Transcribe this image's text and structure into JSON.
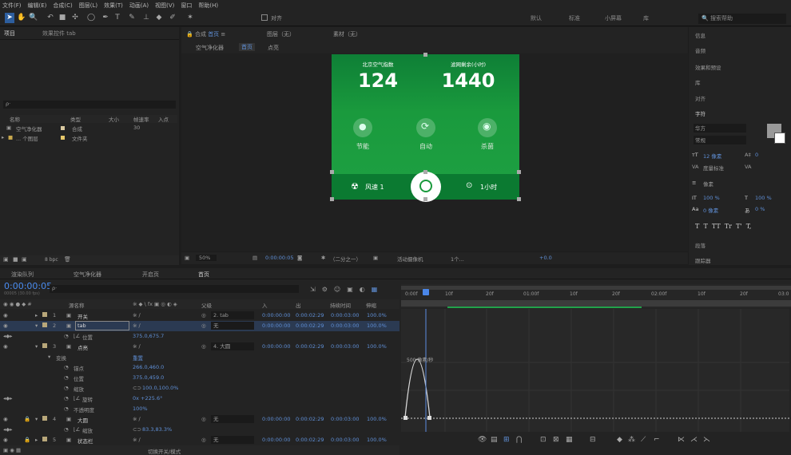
{
  "menu": [
    "文件(F)",
    "编辑(E)",
    "合成(C)",
    "图层(L)",
    "效果(T)",
    "动画(A)",
    "视图(V)",
    "窗口",
    "帮助(H)"
  ],
  "toolbar": {
    "align_label": "对齐",
    "workspaces": [
      "默认",
      "了解",
      "标准",
      "小屏幕",
      "库"
    ],
    "search_help": "搜索帮助"
  },
  "project": {
    "tab": "项目",
    "effects_tab": "效果控件 tab",
    "search": "ρ·",
    "columns": [
      "名称",
      "类型",
      "大小",
      "帧速率",
      "入点"
    ],
    "items": [
      {
        "name": "空气净化器",
        "type": "合成",
        "fps": "30"
      },
      {
        "name": "... 个图层",
        "type": "文件夹"
      }
    ],
    "bpc": "8 bpc"
  },
  "viewer": {
    "tab": "合成",
    "tab_name": "首页",
    "layer_tab": "图层（无）",
    "footage_tab": "素材（无）",
    "breadcrumbs": [
      "空气净化器",
      "首页",
      "点亮"
    ],
    "zoom": "50%",
    "timecode": "0:00:00:05",
    "resolution": "（二分之一）",
    "camera": "活动摄像机",
    "views": "1个...",
    "exposure": "+0.0"
  },
  "screen": {
    "label1": "北京空气指数",
    "value1": "124",
    "label2": "滤网剩余(小时)",
    "value2": "1440",
    "icons": [
      "节能",
      "自动",
      "杀菌"
    ],
    "fan": "风速 1",
    "timer": "1小时"
  },
  "right": {
    "items": [
      "信息",
      "音频",
      "效果和预设",
      "库",
      "对齐"
    ],
    "char_title": "字符",
    "font": "华方",
    "style": "常规",
    "size": "12 像素",
    "leading": "自动",
    "tracking": "像素",
    "scale_v": "100 %",
    "scale_h": "100 %",
    "baseline": "0 像素",
    "tsume": "0 %",
    "kerning": "度量标准",
    "tracking_val": "0",
    "stroke": "像素",
    "para": "段落",
    "tracker": "跟踪器",
    "type_buttons": [
      "T",
      "T",
      "TT",
      "Tr",
      "T'",
      "T,"
    ]
  },
  "timeline": {
    "tabs": [
      "渲染队列",
      "空气净化器",
      "开启页",
      "首页"
    ],
    "timecode": "0:00:00:05",
    "fps_sub": "00005 (30.00 fps)",
    "search": "ρ·",
    "cols": [
      "源名称",
      "父级",
      "入",
      "出",
      "持续时间",
      "伸缩"
    ],
    "layers": [
      {
        "idx": "1",
        "name": "开关",
        "parent": "2. tab",
        "in": "0:00:00:00",
        "out": "0:00:02:29",
        "dur": "0:00:03:00",
        "st": "100.0%"
      },
      {
        "idx": "2",
        "name": "tab",
        "parent": "无",
        "in": "0:00:00:00",
        "out": "0:00:02:29",
        "dur": "0:00:03:00",
        "st": "100.0%"
      },
      {
        "prop": "位置",
        "val": "375.0,675.7"
      },
      {
        "idx": "3",
        "name": "点亮",
        "parent": "4. 大圆",
        "in": "0:00:00:00",
        "out": "0:00:02:29",
        "dur": "0:00:03:00",
        "st": "100.0%"
      },
      {
        "prop": "变换",
        "val": "重置"
      },
      {
        "prop": "锚点",
        "val": "266.0,460.0"
      },
      {
        "prop": "位置",
        "val": "375.0,459.0"
      },
      {
        "prop": "缩放",
        "val": "100.0,100.0%"
      },
      {
        "prop": "旋转",
        "val": "0x +225.6°"
      },
      {
        "prop": "不透明度",
        "val": "100%"
      },
      {
        "idx": "4",
        "name": "大圆",
        "parent": "无",
        "in": "0:00:00:00",
        "out": "0:00:02:29",
        "dur": "0:00:03:00",
        "st": "100.0%"
      },
      {
        "prop": "缩放",
        "val": "83.3,83.3%"
      },
      {
        "idx": "5",
        "name": "状态栏",
        "parent": "无",
        "in": "0:00:00:00",
        "out": "0:00:02:29",
        "dur": "0:00:03:00",
        "st": "100.0%"
      }
    ],
    "ruler": [
      "0:00f",
      "10f",
      "20f",
      "01:00f",
      "10f",
      "20f",
      "02:00f",
      "10f",
      "20f",
      "03:0"
    ],
    "graph_label": "500 像素/秒",
    "footer": "切换开关/模式"
  }
}
